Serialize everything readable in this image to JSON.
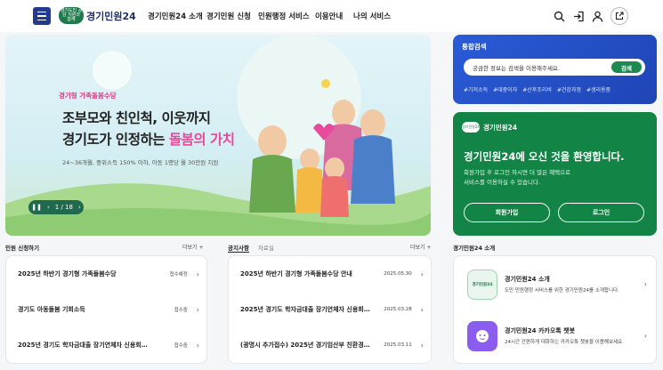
{
  "header": {
    "logo_badge": "경기도민 공감 지원과 함께",
    "logo_text": "경기민원24",
    "nav": [
      "경기민원24 소개",
      "경기민원 신청",
      "민원행정 서비스",
      "이용안내",
      "나의 서비스"
    ]
  },
  "hero": {
    "subtitle": "경기형 가족돌봄수당",
    "title_line1": "조부모와 친인척, 이웃까지",
    "title_line2_plain": "경기도가 인정하는 ",
    "title_line2_accent": "돌봄의 가치",
    "desc": "24~36개월, 중위소득 150% 이하, 아동 1명당 월 30만원 지원",
    "pager": "1 / 18"
  },
  "search": {
    "title": "통합검색",
    "placeholder": "궁금한 정보는 검색을 이용해주세요.",
    "button": "검색",
    "tags": [
      "#기저소득",
      "#대중이자",
      "#산후조리비",
      "#건강과정",
      "#생리용품"
    ]
  },
  "welcome": {
    "badge": "경기민원24",
    "brand": "경기민원24",
    "heading": "경기민원24에 오신 것을 환영합니다.",
    "text1": "회원가입 후 로그인 하시면 더 많은 혜택으로",
    "text2": "서비스를 이용하실 수 있습니다.",
    "join": "회원가입",
    "login": "로그인"
  },
  "apply": {
    "title": "민원 신청하기",
    "more": "더보기 +",
    "items": [
      {
        "title": "2025년 하반기 경기형 가족돌봄수당",
        "status": "접수예정"
      },
      {
        "title": "경기도 아동돌봄 기회소득",
        "status": "접수중"
      },
      {
        "title": "2025년 경기도 학자금대출 장기연체자 신용회…",
        "status": "접수중"
      }
    ]
  },
  "notice": {
    "tab_active": "공지사항",
    "tab_other": "자료실",
    "more": "더보기 +",
    "items": [
      {
        "title": "2025년 하반기 경기형 가족돌봄수당 안내",
        "date": "2025.05.30"
      },
      {
        "title": "2025년 경기도 학자금대출 장기연체자 신용회…",
        "date": "2025.03.28"
      },
      {
        "title": "(광명시 추가접수) 2025년 경기임산부 친환경…",
        "date": "2025.03.11"
      }
    ]
  },
  "intro": {
    "title": "경기민원24 소개",
    "items": [
      {
        "title": "경기민원24 소개",
        "desc": "도민 민원행정 서비스를 위한 경기민원24를 소개합니다.",
        "icon": "경기민원24"
      },
      {
        "title": "경기민원24 카카오톡 챗봇",
        "desc": "24시간 간편하게 대화하는 카카오톡 챗봇을 이용해보세요."
      }
    ]
  },
  "colors": {
    "primary": "#233a8f",
    "green": "#128446",
    "search_blue": "#2a5bd7",
    "accent_pink": "#e8499b"
  }
}
